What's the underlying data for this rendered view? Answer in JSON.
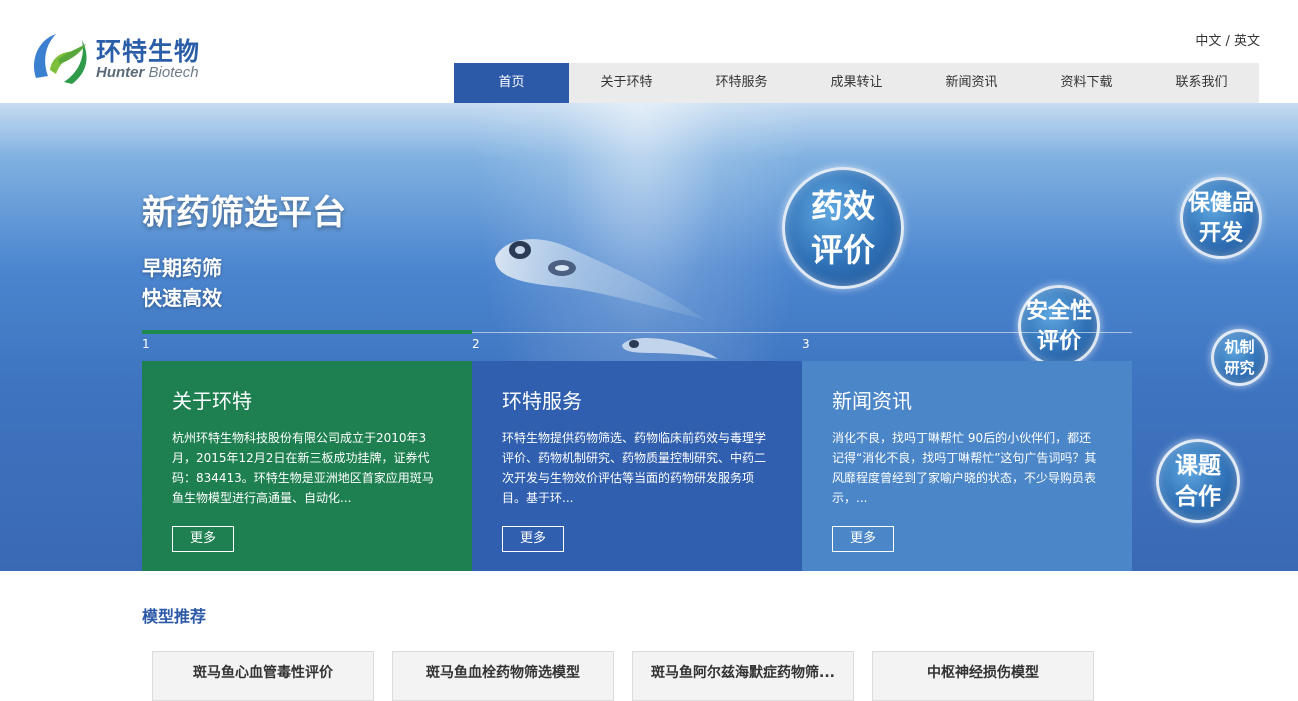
{
  "header": {
    "logo_cn": "环特生物",
    "logo_en_bold": "Hunter",
    "logo_en_light": " Biotech",
    "lang_cn": "中文",
    "lang_sep": " / ",
    "lang_en": "英文"
  },
  "nav": {
    "items": [
      {
        "label": "首页",
        "active": true
      },
      {
        "label": "关于环特"
      },
      {
        "label": "环特服务"
      },
      {
        "label": "成果转让"
      },
      {
        "label": "新闻资讯"
      },
      {
        "label": "资料下载"
      },
      {
        "label": "联系我们"
      }
    ]
  },
  "banner": {
    "title": "新药筛选平台",
    "sub_line1": "早期药筛",
    "sub_line2": "快速高效",
    "bubbles": [
      {
        "l1": "药效",
        "l2": "评价"
      },
      {
        "l1": "保健品",
        "l2": "开发"
      },
      {
        "l1": "安全性",
        "l2": "评价"
      },
      {
        "l1": "机制",
        "l2": "研究"
      },
      {
        "l1": "课题",
        "l2": "合作"
      }
    ],
    "tabs": [
      "1",
      "2",
      "3"
    ]
  },
  "cards": [
    {
      "title": "关于环特",
      "text": "杭州环特生物科技股份有限公司成立于2010年3月，2015年12月2日在新三板成功挂牌，证券代码：834413。环特生物是亚洲地区首家应用斑马鱼生物模型进行高通量、自动化...",
      "button": "更多"
    },
    {
      "title": "环特服务",
      "text": "环特生物提供药物筛选、药物临床前药效与毒理学评价、药物机制研究、药物质量控制研究、中药二次开发与生物效价评估等当面的药物研发服务项目。基于环...",
      "button": "更多"
    },
    {
      "title": "新闻资讯",
      "text": "消化不良，找吗丁啉帮忙 90后的小伙伴们，都还记得“消化不良，找吗丁啉帮忙”这句广告词吗？其风靡程度曾经到了家喻户晓的状态，不少导购员表示，...",
      "button": "更多"
    }
  ],
  "models": {
    "title": "模型推荐",
    "items": [
      "斑马鱼心血管毒性评价",
      "斑马鱼血栓药物筛选模型",
      "斑马鱼阿尔兹海默症药物筛...",
      "中枢神经损伤模型"
    ]
  },
  "colors": {
    "brand_blue": "#2c5aa8",
    "card_green": "#1e8050",
    "card_blue": "#2f5fae",
    "card_light_blue": "#4a86c8"
  }
}
